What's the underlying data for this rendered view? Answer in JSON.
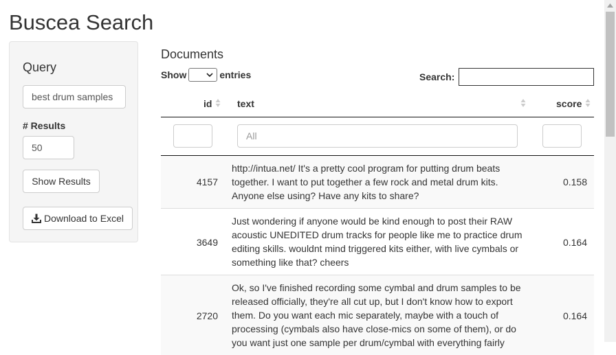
{
  "app": {
    "title": "Buscea Search"
  },
  "sidebar": {
    "query_heading": "Query",
    "query_value": "best drum samples",
    "results_label": "# Results",
    "results_value": "50",
    "show_button": "Show Results",
    "download_button": "Download to Excel"
  },
  "documents": {
    "title": "Documents",
    "show_label": "Show",
    "entries_label": "entries",
    "search_label": "Search:",
    "search_value": "",
    "columns": {
      "id": "id",
      "text": "text",
      "score": "score"
    },
    "filters": {
      "id": "",
      "text_placeholder": "All",
      "score": ""
    },
    "rows": [
      {
        "id": "4157",
        "text": "http://intua.net/ It's a pretty cool program for putting drum beats together. I want to put together a few rock and metal drum kits. Anyone else using? Have any kits to share?",
        "score": "0.158"
      },
      {
        "id": "3649",
        "text": "Just wondering if anyone would be kind enough to post their RAW acoustic UNEDITED drum tracks for people like me to practice drum editing skills. wouldnt mind triggered kits either, with live cymbals or something like that? cheers",
        "score": "0.164"
      },
      {
        "id": "2720",
        "text": "Ok, so I've finished recording some cymbal and drum samples to be released officially, they're all cut up, but I don't know how to export them. Do you want each mic separately, maybe with a touch of processing (cymbals also have close-mics on some of them), or do you want just one sample per drum/cymbal with everything fairly",
        "score": "0.164"
      }
    ]
  }
}
